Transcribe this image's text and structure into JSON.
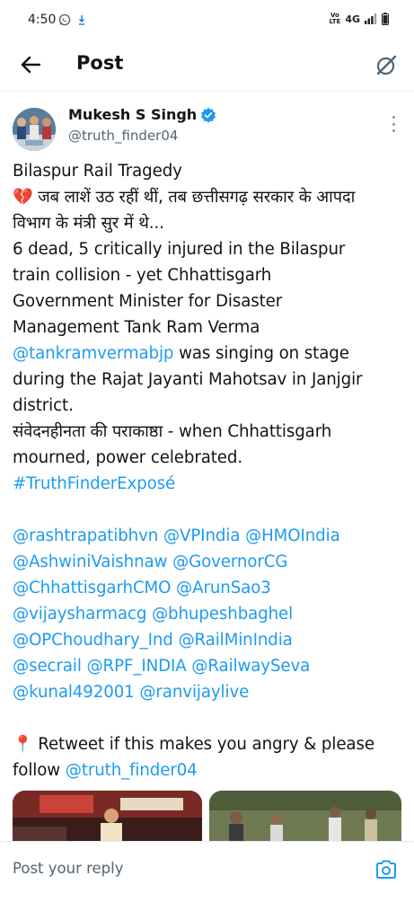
{
  "status_bar": {
    "time": "4:50",
    "volte_top": "Vo",
    "volte_bottom": "LTE",
    "network": "4G"
  },
  "header": {
    "title": "Post"
  },
  "author": {
    "name": "Mukesh S Singh",
    "handle": "@truth_finder04"
  },
  "tweet": {
    "lines": [
      {
        "text": "Bilaspur Rail Tragedy"
      },
      {
        "emoji": "💔",
        "text": " जब लाशें उठ रहीं थीं, तब छत्तीसगढ़ सरकार के आपदा"
      },
      {
        "text": "विभाग के मंत्री सुर में थे..."
      },
      {
        "text": "6 dead, 5 critically injured in the Bilaspur"
      },
      {
        "text": "train collision - yet Chhattisgarh"
      },
      {
        "text": "Government Minister for Disaster"
      },
      {
        "text": "Management Tank Ram Verma"
      },
      {
        "mention": "@tankramvermabjp",
        "text": " was singing on stage"
      },
      {
        "text": "during the Rajat Jayanti Mahotsav in Janjgir"
      },
      {
        "text": "district."
      },
      {
        "text": "संवेदनहीनता की पराकाष्ठा - when Chhattisgarh"
      },
      {
        "text": "mourned, power celebrated."
      },
      {
        "hashtag": "#TruthFinderExposé"
      }
    ],
    "mention_lines": [
      [
        "@rashtrapatibhvn",
        "@VPIndia",
        "@HMOIndia"
      ],
      [
        "@AshwiniVaishnaw",
        "@GovernorCG"
      ],
      [
        "@ChhattisgarhCMO",
        "@ArunSao3"
      ],
      [
        "@vijaysharmacg",
        "@bhupeshbaghel"
      ],
      [
        "@OPChoudhary_Ind",
        "@RailMinIndia"
      ],
      [
        "@secrail",
        "@RPF_INDIA",
        "@RailwaySeva"
      ],
      [
        "@kunal492001",
        "@ranvijaylive"
      ]
    ],
    "cta_pin": "📍",
    "cta_line1": " Retweet if this makes you angry & please",
    "cta_line2_prefix": "follow ",
    "cta_line2_mention": "@truth_finder04"
  },
  "reply": {
    "placeholder": "Post your reply"
  },
  "colors": {
    "link": "#1d9bf0",
    "text": "#0f1419",
    "secondary": "#536471"
  }
}
